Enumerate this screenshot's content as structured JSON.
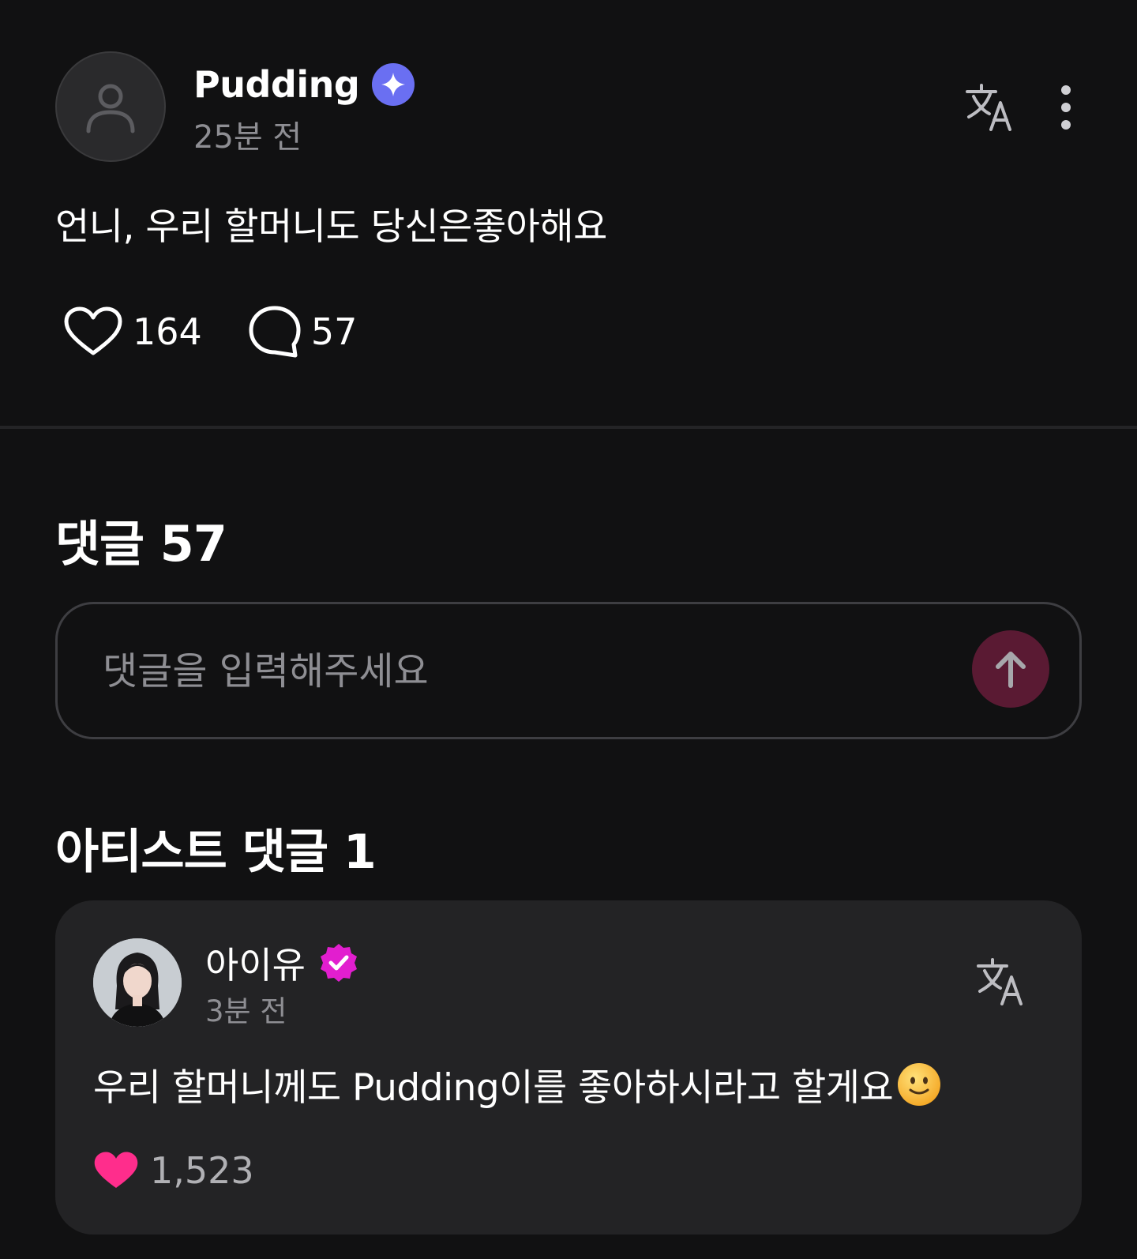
{
  "post": {
    "author": "Pudding",
    "time": "25분 전",
    "text": "언니, 우리 할머니도 당신은좋아해요",
    "likes": "164",
    "comments": "57"
  },
  "comments_section": {
    "title": "댓글 57",
    "input_placeholder": "댓글을 입력해주세요"
  },
  "artist_section": {
    "title": "아티스트 댓글 1",
    "comment": {
      "author": "아이유",
      "time": "3분 전",
      "text": "우리 할머니께도 Pudding이를 좋아하시라고 할게요",
      "likes": "1,523"
    }
  },
  "icons": {
    "verified_badge_color": "#6a6ff2",
    "artist_badge_color": "#e21ecf",
    "send_button_color": "#5a1a33",
    "like_filled_color": "#ff2d8c"
  }
}
